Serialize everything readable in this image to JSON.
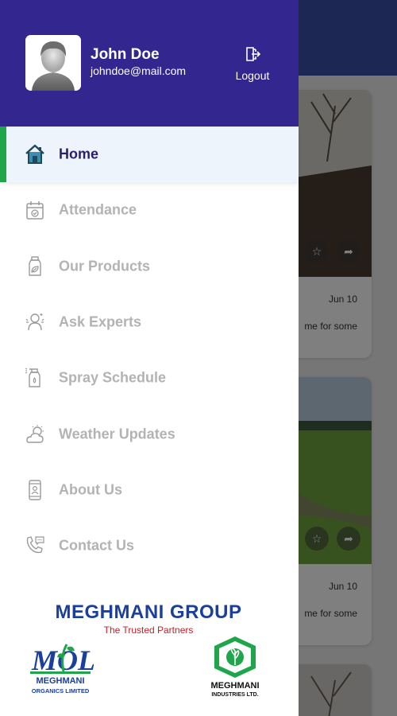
{
  "user": {
    "name": "John Doe",
    "email": "johndoe@mail.com"
  },
  "logout": {
    "label": "Logout",
    "icon": "logout-icon"
  },
  "menu": [
    {
      "label": "Home",
      "icon": "home-icon",
      "active": true
    },
    {
      "label": "Attendance",
      "icon": "calendar-check-icon",
      "active": false
    },
    {
      "label": "Our Products",
      "icon": "product-bottle-icon",
      "active": false
    },
    {
      "label": "Ask Experts",
      "icon": "expert-icon",
      "active": false
    },
    {
      "label": "Spray Schedule",
      "icon": "spray-bottle-icon",
      "active": false
    },
    {
      "label": "Weather Updates",
      "icon": "weather-icon",
      "active": false
    },
    {
      "label": "About Us",
      "icon": "about-device-icon",
      "active": false
    },
    {
      "label": "Contact Us",
      "icon": "phone-chat-icon",
      "active": false
    }
  ],
  "brand": {
    "name": "MEGHMANI GROUP",
    "tagline": "The Trusted Partners",
    "logo_left_text": "MOL",
    "logo_left_name": "MEGHMANI",
    "logo_left_sub": "ORGANICS LIMITED",
    "logo_right_name": "MEGHMANI",
    "logo_right_sub": "INDUSTRIES LTD."
  },
  "background_feed": {
    "cards": [
      {
        "date": "Jun 10",
        "snippet": "me for some"
      },
      {
        "date": "Jun 10",
        "snippet": "me for some"
      }
    ]
  },
  "colors": {
    "drawer_header": "#33278f",
    "active_indicator": "#1fa64b",
    "active_bg": "#eef4fb",
    "active_text": "#2a1f6e",
    "inactive_text": "#b3b3b3",
    "brand_blue": "#1b3f9c",
    "brand_red": "#c4202b"
  }
}
